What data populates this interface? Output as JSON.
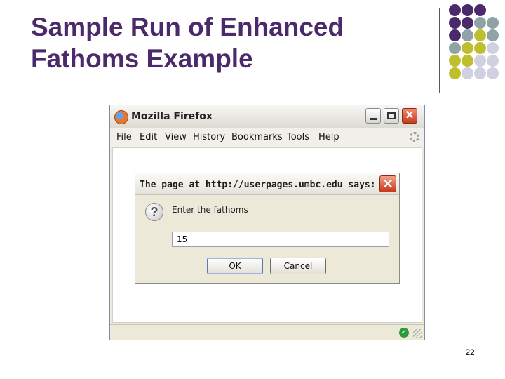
{
  "slide": {
    "title_line1": "Sample Run of Enhanced",
    "title_line2": "Fathoms Example",
    "page_number": "22",
    "colors": {
      "title": "#4b2a6b",
      "purple": "#4b2a6b",
      "teal": "#8fa3a6",
      "olive": "#bfbf2e",
      "lavender": "#d1d0e0"
    }
  },
  "browser": {
    "title": "Mozilla Firefox",
    "menu": [
      "File",
      "Edit",
      "View",
      "History",
      "Bookmarks",
      "Tools",
      "Help"
    ]
  },
  "dialog": {
    "title": "The page at http://userpages.umbc.edu says:",
    "message": "Enter the fathoms",
    "input_value": "15",
    "ok_label": "OK",
    "cancel_label": "Cancel",
    "icon": "question-icon"
  }
}
